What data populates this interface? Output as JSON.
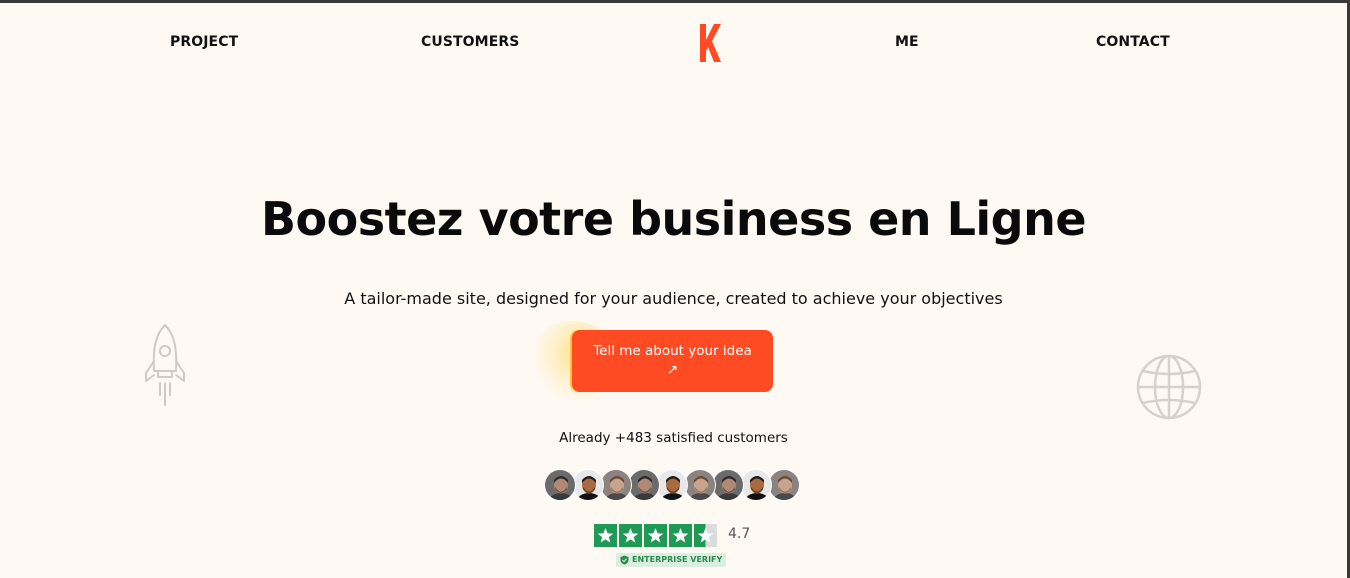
{
  "nav": {
    "links": [
      "PROJECT",
      "CUSTOMERS",
      "ME",
      "CONTACT"
    ],
    "logo_letter": "K",
    "accent_color": "#ff4b23"
  },
  "hero": {
    "headline": "Boostez votre business en Ligne",
    "subtitle": "A tailor-made site, designed for your audience, created to achieve your objectives",
    "cta_label": "Tell me about your idea ↗",
    "decor_icons": [
      "rocket-icon",
      "globe-icon"
    ]
  },
  "social_proof": {
    "satisfied_text": "Already +483 satisfied customers",
    "avatar_count": 9,
    "rating_value": "4.7",
    "stars": 4.5,
    "stars_max": 5,
    "star_color": "#1f9a55",
    "verify_badge": "ENTERPRISE VERIFY"
  },
  "colors": {
    "background": "#fff9f4",
    "text": "#111111"
  }
}
